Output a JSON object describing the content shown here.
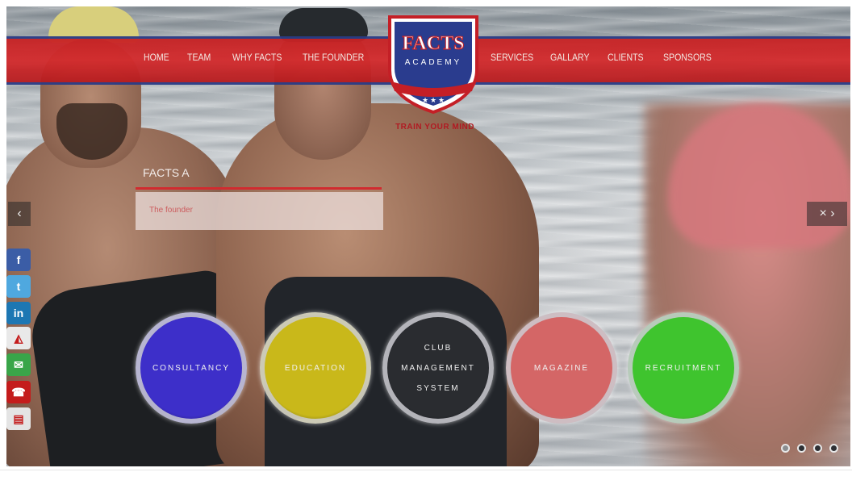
{
  "nav": {
    "left": [
      "HOME",
      "TEAM",
      "WHY FACTS",
      "THE FOUNDER"
    ],
    "right": [
      "SERVICES",
      "GALLARY",
      "CLIENTS",
      "SPONSORS"
    ]
  },
  "logo": {
    "line1": "FACTS",
    "line2": "ACADEMY",
    "tagline": "TRAIN YOUR MIND"
  },
  "slide": {
    "title": "FACTS A",
    "text": "The founder"
  },
  "arrows": {
    "prev": "‹",
    "next": "›"
  },
  "circles": [
    {
      "label": "CONSULTANCY",
      "color": "#3d2fc9"
    },
    {
      "label": "EDUCATION",
      "color": "#c9b81a"
    },
    {
      "label": "CLUB MANAGEMENT SYSTEM",
      "lines": [
        "CLUB",
        "MANAGEMENT",
        "SYSTEM"
      ],
      "color": "#2a2c30"
    },
    {
      "label": "MAGAZINE",
      "color": "#d46666"
    },
    {
      "label": "RECRUITMENT",
      "color": "#3fc42e"
    }
  ],
  "social": [
    {
      "icon": "facebook-icon",
      "glyph": "f",
      "color": "#3b5da6"
    },
    {
      "icon": "twitter-icon",
      "glyph": "t",
      "color": "#4fa8df"
    },
    {
      "icon": "linkedin-icon",
      "glyph": "in",
      "color": "#1d77b3"
    },
    {
      "icon": "network-icon",
      "glyph": "◭",
      "color": "#e9e9e9"
    },
    {
      "icon": "email-icon",
      "glyph": "✉",
      "color": "#39a549"
    },
    {
      "icon": "phone-icon",
      "glyph": "☎",
      "color": "#c41c1c"
    },
    {
      "icon": "contact-card-icon",
      "glyph": "▤",
      "color": "#e4e4e4"
    }
  ],
  "pagination": {
    "count": 4,
    "active": 0
  }
}
